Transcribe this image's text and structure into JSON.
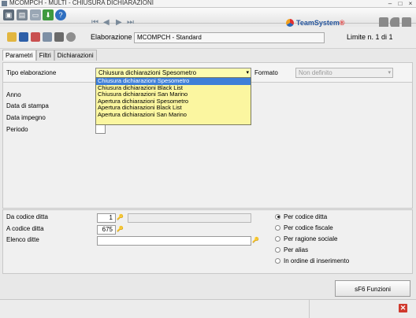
{
  "window": {
    "title": "MCOMPCH - MULTI - CHIUSURA DICHIARAZIONI"
  },
  "brand": {
    "name": "TeamSystem",
    "mark": "®"
  },
  "header": {
    "elaborazione_label": "Elaborazione",
    "elaborazione_value": "MCOMPCH - Standard",
    "limite": "Limite n. 1 di 1"
  },
  "tabs": [
    {
      "label": "Parametri",
      "active": true
    },
    {
      "label": "Filtri",
      "active": false
    },
    {
      "label": "Dichiarazioni",
      "active": false
    }
  ],
  "params": {
    "tipo_label": "Tipo elaborazione",
    "tipo_value": "Chiusura dichiarazioni Spesometro",
    "formato_label": "Formato",
    "formato_value": "Non definito",
    "options": [
      "Chiusura dichiarazioni Spesometro",
      "Chiusura dichiarazioni Black List",
      "Chiusura dichiarazioni San Marino",
      "Apertura dichiarazioni Spesometro",
      "Apertura dichiarazioni Black List",
      "Apertura dichiarazioni San Marino"
    ],
    "anno_label": "Anno",
    "data_stampa_label": "Data di stampa",
    "data_impegno_label": "Data impegno",
    "periodo_label": "Periodo"
  },
  "filters": {
    "da_codice_label": "Da codice ditta",
    "da_codice_value": "1",
    "a_codice_label": "A codice ditta",
    "a_codice_value": "675",
    "elenco_label": "Elenco ditte",
    "elenco_value": ""
  },
  "ordering": [
    {
      "label": "Per codice ditta",
      "selected": true
    },
    {
      "label": "Per codice fiscale",
      "selected": false
    },
    {
      "label": "Per ragione sociale",
      "selected": false
    },
    {
      "label": "Per alias",
      "selected": false
    },
    {
      "label": "In ordine di inserimento",
      "selected": false
    }
  ],
  "footer": {
    "functions_button": "sF6 Funzioni"
  },
  "icons": {
    "key": "🔑",
    "close": "✕"
  }
}
